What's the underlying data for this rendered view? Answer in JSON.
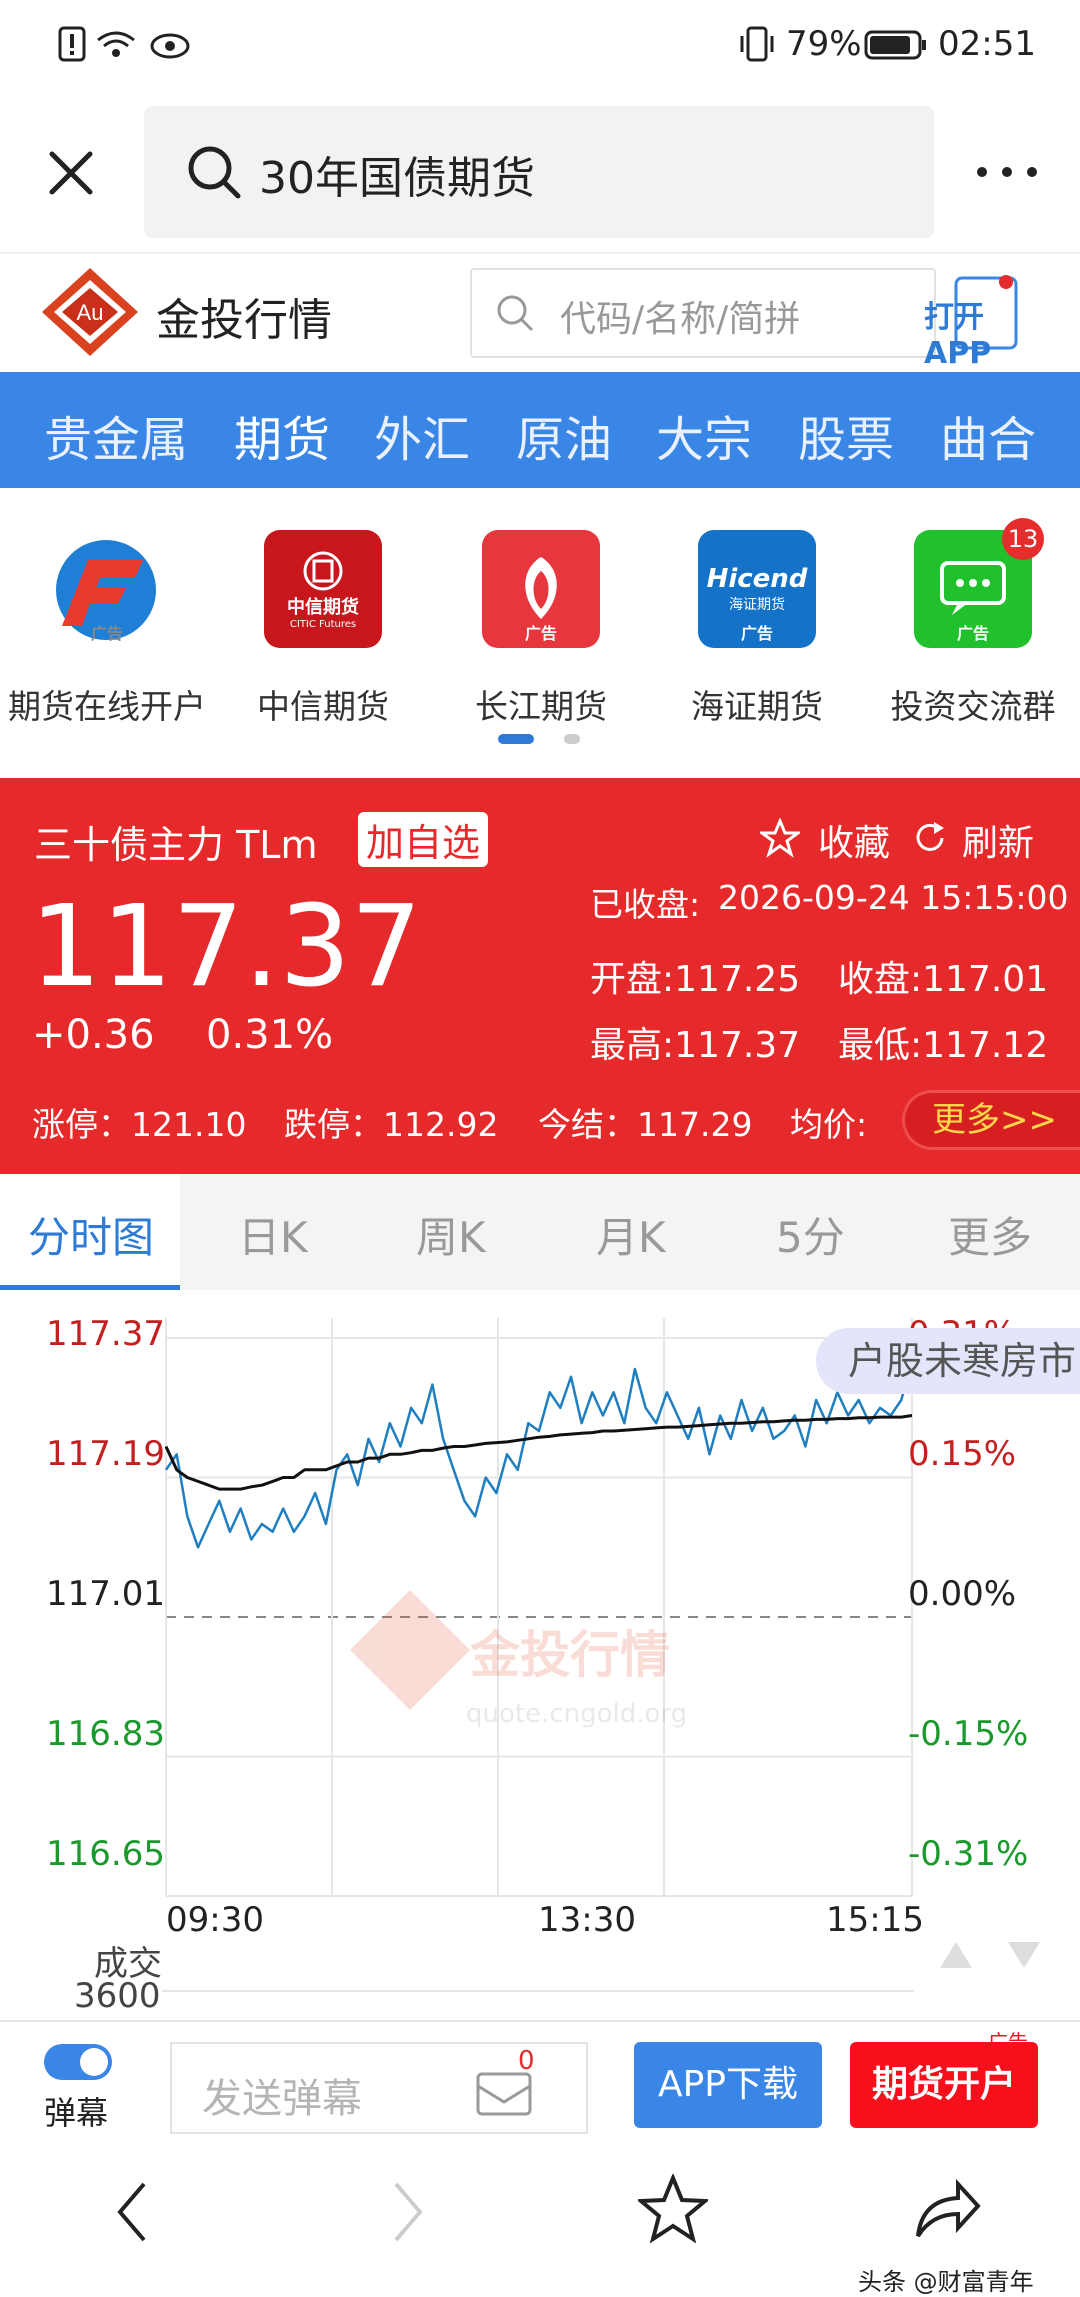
{
  "status": {
    "battery_pct": "79%",
    "time": "02:51"
  },
  "browser": {
    "query": "30年国债期货"
  },
  "site": {
    "name": "金投行情",
    "logo_text": "Au",
    "search_placeholder": "代码/名称/简拼",
    "open_app": "打开APP"
  },
  "nav": {
    "items": [
      "贵金属",
      "期货",
      "外汇",
      "原油",
      "大宗",
      "股票",
      "曲合"
    ],
    "active": "期货"
  },
  "apps": [
    {
      "label": "期货在线开户",
      "ad": "广告",
      "color": "#ffffff"
    },
    {
      "label": "中信期货",
      "ad": "",
      "color": "#c8161d",
      "icon_text": "中信期货",
      "icon_sub": "CITIC Futures"
    },
    {
      "label": "长江期货",
      "ad": "广告",
      "color": "#e8363f"
    },
    {
      "label": "海证期货",
      "ad": "广告",
      "color": "#1473c8",
      "icon_text": "Hicend",
      "icon_sub": "海证期货"
    },
    {
      "label": "投资交流群",
      "ad": "广告",
      "color": "#20c12c",
      "badge": "13"
    }
  ],
  "quote": {
    "name": "三十债主力 TLm",
    "add_fav": "加自选",
    "collect": "收藏",
    "refresh": "刷新",
    "closed_label": "已收盘:",
    "closed_time": "2026-09-24 15:15:00",
    "price": "117.37",
    "change": "+0.36",
    "change_pct": "0.31%",
    "open": "开盘:117.25",
    "close": "收盘:117.01",
    "high": "最高:117.37",
    "low": "最低:117.12",
    "limit_up": "涨停：121.10",
    "limit_down": "跌停：112.92",
    "settle": "今结：117.29",
    "avg": "均价:",
    "more": "更多>>"
  },
  "tabs": [
    "分时图",
    "日K",
    "周K",
    "月K",
    "5分",
    "更多"
  ],
  "chart_data": {
    "type": "line",
    "y_labels_left": [
      "117.37",
      "117.19",
      "117.01",
      "116.83",
      "116.65"
    ],
    "y_labels_right": [
      "0.31%",
      "0.15%",
      "0.00%",
      "-0.15%",
      "-0.31%"
    ],
    "x_labels": [
      "09:30",
      "13:30",
      "15:15"
    ],
    "ylim": [
      116.65,
      117.37
    ],
    "reference": 117.01,
    "series": [
      {
        "values": [
          117.2,
          117.22,
          117.14,
          117.1,
          117.13,
          117.16,
          117.12,
          117.15,
          117.11,
          117.13,
          117.12,
          117.15,
          117.12,
          117.14,
          117.17,
          117.13,
          117.2,
          117.22,
          117.18,
          117.24,
          117.21,
          117.26,
          117.23,
          117.28,
          117.26,
          117.31,
          117.24,
          117.2,
          117.16,
          117.14,
          117.19,
          117.17,
          117.22,
          117.2,
          117.26,
          117.25,
          117.3,
          117.28,
          117.32,
          117.26,
          117.3,
          117.27,
          117.3,
          117.26,
          117.33,
          117.28,
          117.26,
          117.3,
          117.27,
          117.24,
          117.28,
          117.22,
          117.27,
          117.24,
          117.29,
          117.25,
          117.28,
          117.24,
          117.25,
          117.27,
          117.23,
          117.29,
          117.26,
          117.3,
          117.27,
          117.29,
          117.26,
          117.28,
          117.27,
          117.29,
          117.34
        ]
      },
      {
        "values": [
          117.23,
          117.2,
          117.19,
          117.185,
          117.18,
          117.175,
          117.175,
          117.175,
          117.178,
          117.18,
          117.185,
          117.19,
          117.19,
          117.2,
          117.2,
          117.2,
          117.205,
          117.21,
          117.21,
          117.215,
          117.215,
          117.22,
          117.22,
          117.222,
          117.225,
          117.225,
          117.228,
          117.23,
          117.23,
          117.232,
          117.234,
          117.235,
          117.236,
          117.238,
          117.24,
          117.242,
          117.243,
          117.245,
          117.246,
          117.247,
          117.248,
          117.25,
          117.25,
          117.251,
          117.252,
          117.253,
          117.254,
          117.255,
          117.255,
          117.256,
          117.257,
          117.258,
          117.259,
          117.26,
          117.26,
          117.261,
          117.262,
          117.262,
          117.263,
          117.264,
          117.264,
          117.265,
          117.265,
          117.266,
          117.266,
          117.267,
          117.267,
          117.268,
          117.268,
          117.268,
          117.27
        ]
      }
    ]
  },
  "chart_extra": {
    "watermark": "金投行情",
    "watermark_url": "quote.cngold.org",
    "ticker": "户股未寒房市",
    "volume_label": "成交",
    "volume_value": "3600"
  },
  "actbar": {
    "danmu": "弹幕",
    "danmu_placeholder": "发送弹幕",
    "msg_count": "0",
    "app_download": "APP下载",
    "futures_open": "期货开户",
    "ad": "广告"
  },
  "watermark_bottom": "头条 @财富青年"
}
